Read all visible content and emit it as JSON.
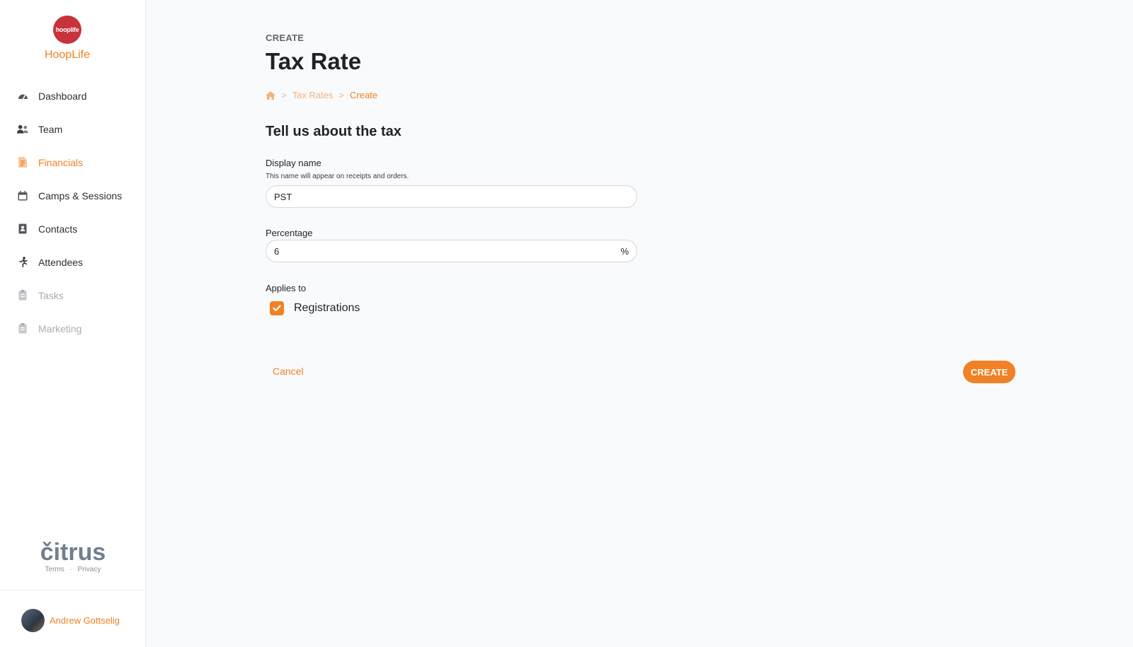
{
  "brand": {
    "logo_text": "hooplife",
    "name": "HoopLife",
    "accent_color": "#f08124",
    "logo_color": "#c8323b"
  },
  "nav": {
    "items": [
      {
        "label": "Dashboard",
        "icon": "speedometer-icon",
        "state": "normal"
      },
      {
        "label": "Team",
        "icon": "people-icon",
        "state": "normal"
      },
      {
        "label": "Financials",
        "icon": "receipt-icon",
        "state": "active"
      },
      {
        "label": "Camps & Sessions",
        "icon": "calendar-icon",
        "state": "normal"
      },
      {
        "label": "Contacts",
        "icon": "address-book-icon",
        "state": "normal"
      },
      {
        "label": "Attendees",
        "icon": "running-person-icon",
        "state": "normal"
      },
      {
        "label": "Tasks",
        "icon": "clipboard-icon",
        "state": "disabled"
      },
      {
        "label": "Marketing",
        "icon": "clipboard-icon",
        "state": "disabled"
      }
    ]
  },
  "footer": {
    "citrus_logo": "čitrus",
    "terms": "Terms",
    "dot": "·",
    "privacy": "Privacy",
    "user_name": "Andrew Gottselig"
  },
  "header": {
    "eyebrow": "CREATE",
    "title": "Tax Rate",
    "breadcrumb": {
      "home_icon": "home-icon",
      "sep": ">",
      "parent": "Tax Rates",
      "current": "Create"
    }
  },
  "form": {
    "section_title": "Tell us about the tax",
    "display_name": {
      "label": "Display name",
      "hint": "This name will appear on receipts and orders.",
      "value": "PST"
    },
    "percentage": {
      "label": "Percentage",
      "value": "6",
      "suffix": "%"
    },
    "applies_to": {
      "label": "Applies to",
      "option": "Registrations",
      "checked": true
    },
    "cancel_label": "Cancel",
    "create_label": "CREATE"
  }
}
